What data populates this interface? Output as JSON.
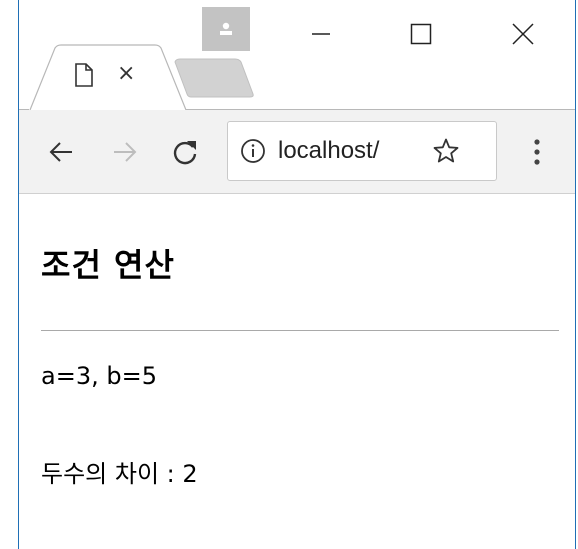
{
  "browser": {
    "tab": {
      "close_glyph": "×"
    },
    "toolbar": {
      "url": "localhost/"
    }
  },
  "page": {
    "title": "조건 연산",
    "values_line": "a=3, b=5",
    "result_line": "두수의 차이 : 2"
  },
  "colors": {
    "window_border": "#1f6fb5",
    "toolbar_bg": "#f2f2f2",
    "profile_badge": "#c3c3c3",
    "divider": "#a9a9a9"
  },
  "icons": [
    "user-icon",
    "minimize-icon",
    "maximize-icon",
    "close-icon",
    "page-icon",
    "back-arrow-icon",
    "forward-arrow-icon",
    "reload-icon",
    "info-icon",
    "star-icon",
    "more-vert-icon"
  ]
}
